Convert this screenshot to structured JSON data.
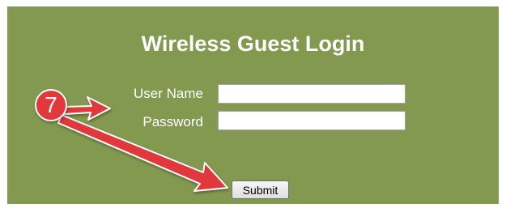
{
  "form": {
    "title": "Wireless Guest Login",
    "username_label": "User Name",
    "password_label": "Password",
    "username_value": "",
    "password_value": "",
    "submit_label": "Submit"
  },
  "annotation": {
    "step_number": "7",
    "color": "#e0383b"
  },
  "colors": {
    "panel_background": "#82994f",
    "text": "#ffffff"
  }
}
